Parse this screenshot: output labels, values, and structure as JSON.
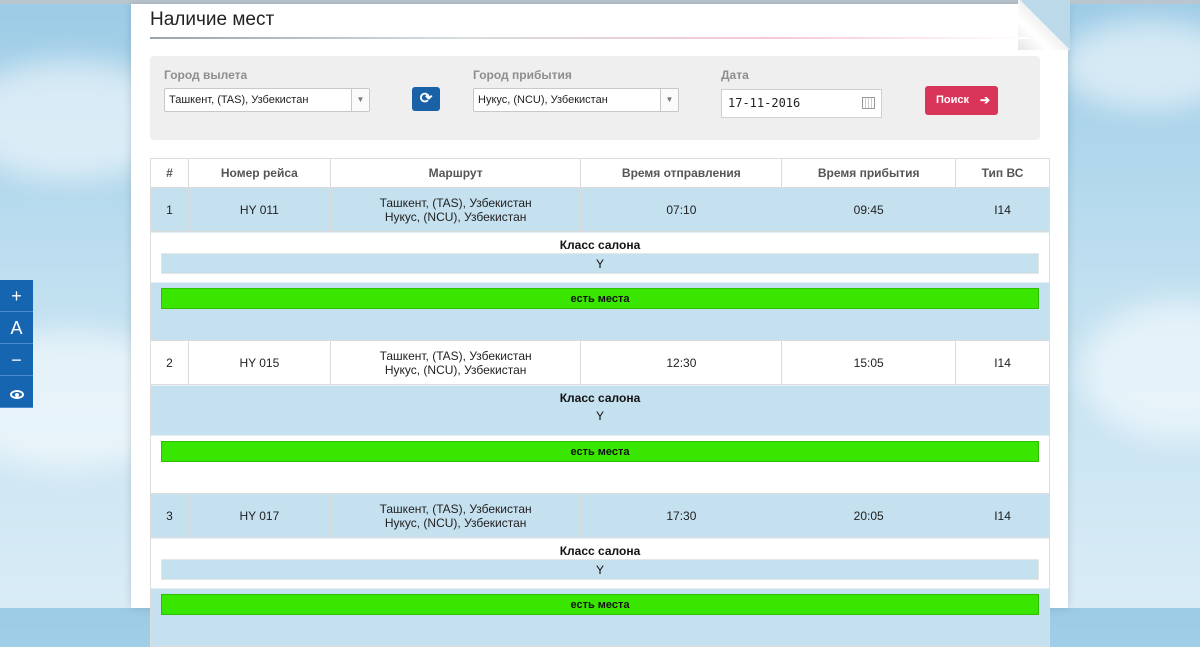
{
  "page": {
    "title": "Наличие мест"
  },
  "filters": {
    "departure_label": "Город вылета",
    "departure_value": "Ташкент, (TAS), Узбекистан",
    "arrival_label": "Город прибытия",
    "arrival_value": "Нукус, (NCU), Узбекистан",
    "date_label": "Дата",
    "date_value": "17-11-2016",
    "search_label": "Поиск",
    "icons": {
      "swap": "refresh-icon",
      "calendar": "calendar-icon",
      "search_arrow": "arrow-right-icon",
      "dropdown": "chevron-down-icon"
    }
  },
  "table": {
    "headers": [
      "#",
      "Номер рейса",
      "Маршрут",
      "Время отправления",
      "Время прибытия",
      "Тип ВС"
    ],
    "class_label": "Класс салона",
    "seats_label": "есть места",
    "rows": [
      {
        "num": "1",
        "flight": "HY 011",
        "route_from": "Ташкент, (TAS), Узбекистан",
        "route_to": "Нукус, (NCU), Узбекистан",
        "departure": "07:10",
        "arrival": "09:45",
        "aircraft": "I14",
        "class": "Y"
      },
      {
        "num": "2",
        "flight": "HY 015",
        "route_from": "Ташкент, (TAS), Узбекистан",
        "route_to": "Нукус, (NCU), Узбекистан",
        "departure": "12:30",
        "arrival": "15:05",
        "aircraft": "I14",
        "class": "Y"
      },
      {
        "num": "3",
        "flight": "HY 017",
        "route_from": "Ташкент, (TAS), Узбекистан",
        "route_to": "Нукус, (NCU), Узбекистан",
        "departure": "17:30",
        "arrival": "20:05",
        "aircraft": "I14",
        "class": "Y"
      }
    ]
  },
  "accessibility": {
    "buttons": [
      {
        "label": "+",
        "icon": "zoom-in-icon"
      },
      {
        "label": "A",
        "icon": "font-reset-icon"
      },
      {
        "label": "−",
        "icon": "zoom-out-icon"
      },
      {
        "label": "",
        "icon": "eye-icon"
      }
    ]
  },
  "colors": {
    "accent": "#1a62a8",
    "search": "#d9345a",
    "available": "#39e600",
    "row_blue": "#c5e0ef"
  }
}
